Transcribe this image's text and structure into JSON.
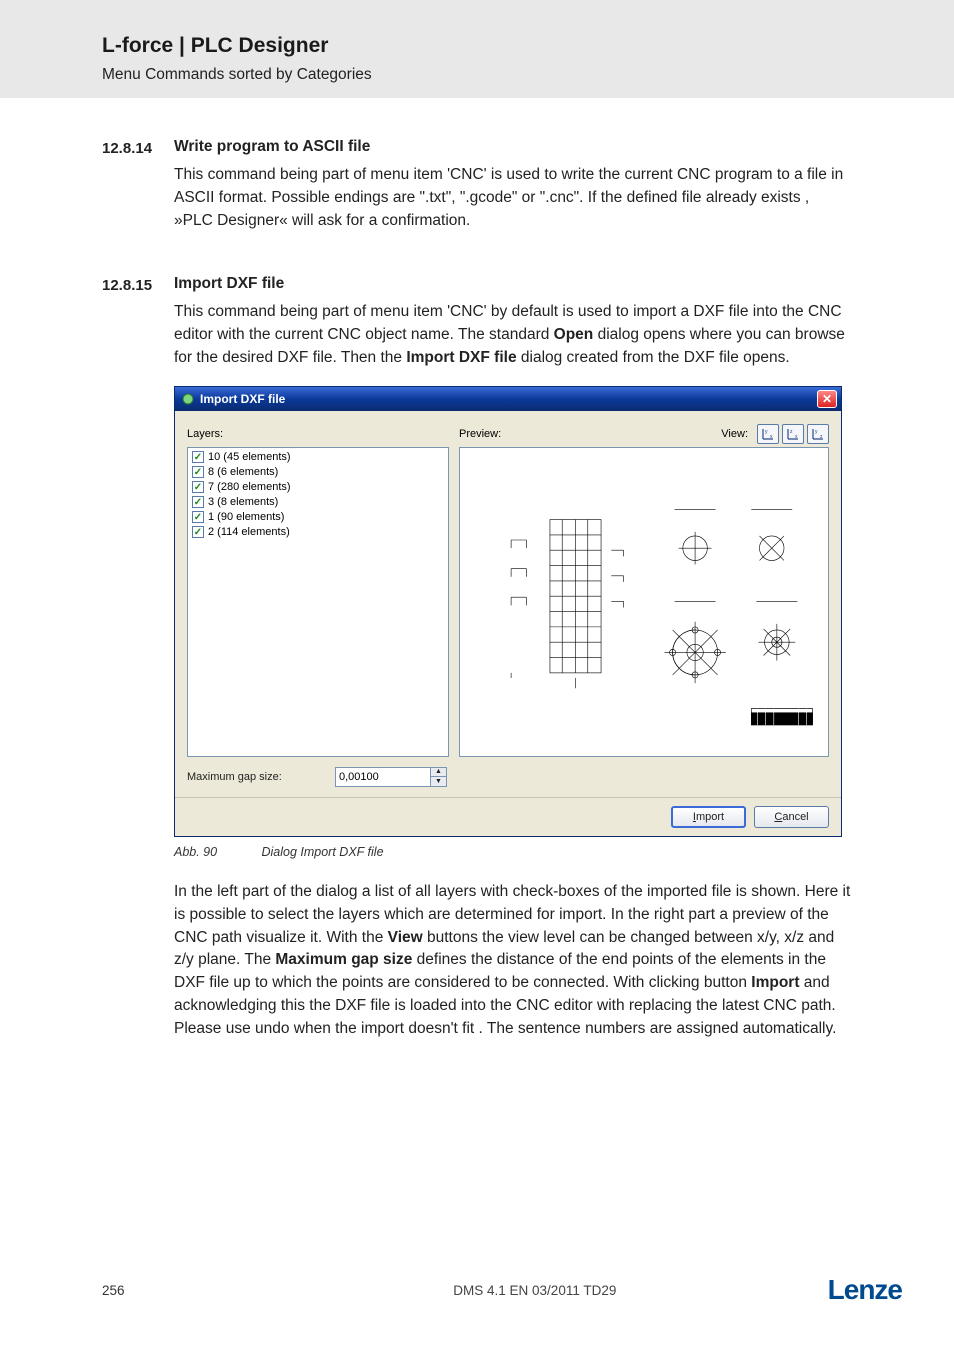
{
  "header": {
    "title": "L-force | PLC Designer",
    "subheading": "Menu Commands sorted by Categories"
  },
  "section_14": {
    "num": "12.8.14",
    "title": "Write program to ASCII file",
    "text": "This command being part of menu item 'CNC' is used to write the current CNC program to a file in ASCII format. Possible endings are \".txt\", \".gcode\" or \".cnc\". If the defined file already exists , »PLC Designer« will ask for a confirmation."
  },
  "section_15": {
    "num": "12.8.15",
    "title": "Import DXF file",
    "pre_html": "This command being part of menu item 'CNC' by default is used to import a DXF file into the CNC editor with the current CNC object name. The standard <b>Open</b> dialog opens where you can browse for the desired DXF file. Then the <b>Import DXF file</b> dialog created from the DXF file opens.",
    "post_html": "In the left part of the dialog a list  of all layers with check-boxes of the imported file is shown. Here it is possible to select the layers which are determined for import.  In the right part a preview of the CNC path visualize it. With the <b>View</b> buttons the view level can be changed between x/y, x/z and z/y plane. The <b>Maximum gap size</b> defines the distance of the end points of the elements in the DXF file up to which the points are considered to be connected. With clicking button <b>Import</b> and acknowledging this the DXF file is loaded into the CNC editor with replacing the latest CNC path. Please use undo when the import doesn't fit . The sentence numbers are assigned automatically."
  },
  "dialog": {
    "title": "Import DXF file",
    "layers_label": "Layers:",
    "preview_label": "Preview:",
    "view_label": "View:",
    "layers": [
      "10 (45 elements)",
      "8 (6 elements)",
      "7 (280 elements)",
      "3 (8 elements)",
      "1 (90 elements)",
      "2 (114 elements)"
    ],
    "gap_label": "Maximum gap size:",
    "gap_value": "0,00100",
    "import_btn": "Import",
    "cancel_btn": "Cancel"
  },
  "caption": {
    "label": "Abb. 90",
    "text": "Dialog Import DXF file"
  },
  "footer": {
    "page": "256",
    "doc": "DMS 4.1 EN 03/2011 TD29",
    "logo": "Lenze"
  }
}
